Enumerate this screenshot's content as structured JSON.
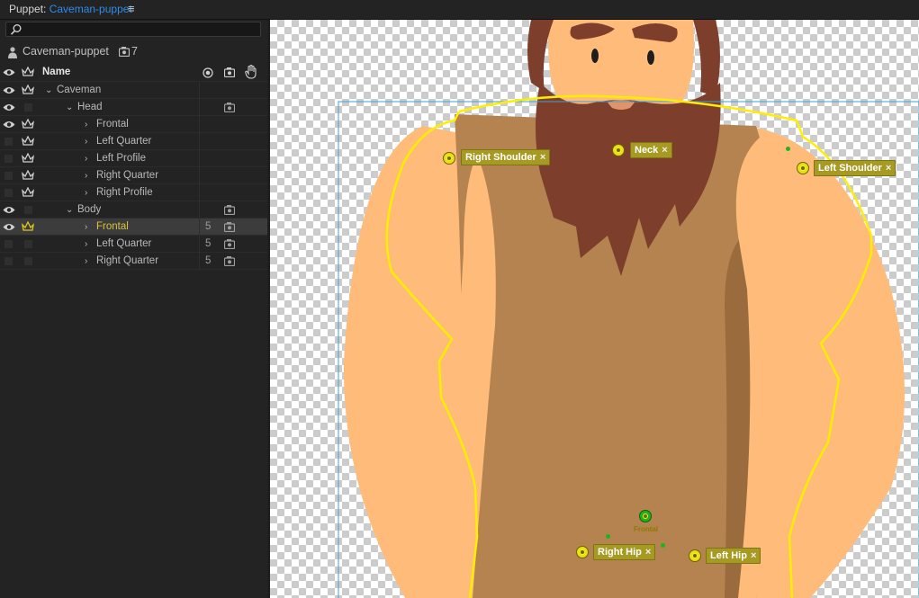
{
  "titlebar": {
    "prefix": "Puppet: ",
    "document": "Caveman-puppet",
    "menu_icon": "≡"
  },
  "search": {
    "placeholder": "",
    "value": "",
    "icon": "search-icon"
  },
  "puppet": {
    "name": "Caveman-puppet",
    "count": "7"
  },
  "columns": {
    "name": "Name"
  },
  "layers": [
    {
      "label": "Caveman",
      "indent": 1,
      "caret": "⌄",
      "eye": true,
      "crown": true,
      "num": "",
      "cam": false,
      "selected": false
    },
    {
      "label": "Head",
      "indent": 2,
      "caret": "⌄",
      "eye": true,
      "crown": false,
      "num": "",
      "cam": true,
      "selected": false
    },
    {
      "label": "Frontal",
      "indent": 3,
      "caret": "›",
      "eye": true,
      "crown": true,
      "num": "",
      "cam": false,
      "selected": false
    },
    {
      "label": "Left Quarter",
      "indent": 3,
      "caret": "›",
      "eye": false,
      "crown": true,
      "num": "",
      "cam": false,
      "selected": false
    },
    {
      "label": "Left Profile",
      "indent": 3,
      "caret": "›",
      "eye": false,
      "crown": true,
      "num": "",
      "cam": false,
      "selected": false
    },
    {
      "label": "Right Quarter",
      "indent": 3,
      "caret": "›",
      "eye": false,
      "crown": true,
      "num": "",
      "cam": false,
      "selected": false
    },
    {
      "label": "Right Profile",
      "indent": 3,
      "caret": "›",
      "eye": false,
      "crown": true,
      "num": "",
      "cam": false,
      "selected": false
    },
    {
      "label": "Body",
      "indent": 2,
      "caret": "⌄",
      "eye": true,
      "crown": false,
      "num": "",
      "cam": true,
      "selected": false
    },
    {
      "label": "Frontal",
      "indent": 3,
      "caret": "›",
      "eye": true,
      "crown": true,
      "num": "5",
      "cam": true,
      "selected": true
    },
    {
      "label": "Left Quarter",
      "indent": 3,
      "caret": "›",
      "eye": false,
      "crown": false,
      "num": "5",
      "cam": true,
      "selected": false
    },
    {
      "label": "Right Quarter",
      "indent": 3,
      "caret": "›",
      "eye": false,
      "crown": false,
      "num": "5",
      "cam": true,
      "selected": false
    }
  ],
  "handles": {
    "right_shoulder": "Right Shoulder",
    "neck": "Neck",
    "left_shoulder": "Left Shoulder",
    "right_hip": "Right Hip",
    "left_hip": "Left Hip",
    "frontal": "Frontal",
    "close": "×"
  },
  "colors": {
    "accent": "#2d8ceb",
    "selected_text": "#d8c53a",
    "tag_bg": "#a69a22",
    "outline": "#ffee00",
    "skin": "#ffbb7a",
    "tunic": "#b5834f",
    "beard": "#7d3f2b"
  }
}
